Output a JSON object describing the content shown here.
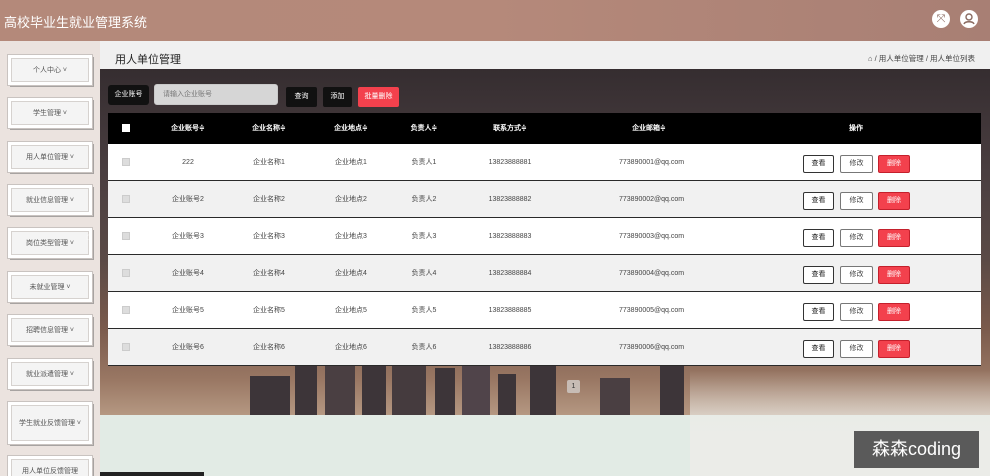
{
  "header": {
    "title": "高校毕业生就业管理系统",
    "icons": [
      "fullscreen-icon",
      "user-icon"
    ]
  },
  "sidebar": {
    "items": [
      {
        "label": "个人中心 ˅"
      },
      {
        "label": "学生管理 ˅"
      },
      {
        "label": "用人单位管理 ˅"
      },
      {
        "label": "就业信息管理 ˅"
      },
      {
        "label": "岗位类型管理 ˅"
      },
      {
        "label": "未就业管理 ˅"
      },
      {
        "label": "招聘信息管理 ˅"
      },
      {
        "label": "就业派遣管理 ˅"
      },
      {
        "label": "学生就业反馈管理 ˅"
      },
      {
        "label": "用人单位反馈管理"
      }
    ]
  },
  "page": {
    "title": "用人单位管理",
    "breadcrumb": "⌂ / 用人单位管理 / 用人单位列表"
  },
  "toolbar": {
    "search_label": "企业账号",
    "search_placeholder": "请输入企业账号",
    "query_label": "查询",
    "add_label": "添加",
    "batch_delete_label": "批量删除"
  },
  "table": {
    "columns": [
      "企业账号≑",
      "企业名称≑",
      "企业地点≑",
      "负责人≑",
      "联系方式≑",
      "企业邮箱≑",
      "操作"
    ],
    "action_labels": {
      "view": "查看",
      "edit": "修改",
      "delete": "删除"
    },
    "rows": [
      {
        "account": "222",
        "name": "企业名称1",
        "place": "企业地点1",
        "person": "负责人1",
        "phone": "13823888881",
        "email": "773890001@qq.com"
      },
      {
        "account": "企业账号2",
        "name": "企业名称2",
        "place": "企业地点2",
        "person": "负责人2",
        "phone": "13823888882",
        "email": "773890002@qq.com"
      },
      {
        "account": "企业账号3",
        "name": "企业名称3",
        "place": "企业地点3",
        "person": "负责人3",
        "phone": "13823888883",
        "email": "773890003@qq.com"
      },
      {
        "account": "企业账号4",
        "name": "企业名称4",
        "place": "企业地点4",
        "person": "负责人4",
        "phone": "13823888884",
        "email": "773890004@qq.com"
      },
      {
        "account": "企业账号5",
        "name": "企业名称5",
        "place": "企业地点5",
        "person": "负责人5",
        "phone": "13823888885",
        "email": "773890005@qq.com"
      },
      {
        "account": "企业账号6",
        "name": "企业名称6",
        "place": "企业地点6",
        "person": "负责人6",
        "phone": "13823888886",
        "email": "773890006@qq.com"
      }
    ]
  },
  "pagination": {
    "current": "1"
  },
  "watermark": "森森coding"
}
